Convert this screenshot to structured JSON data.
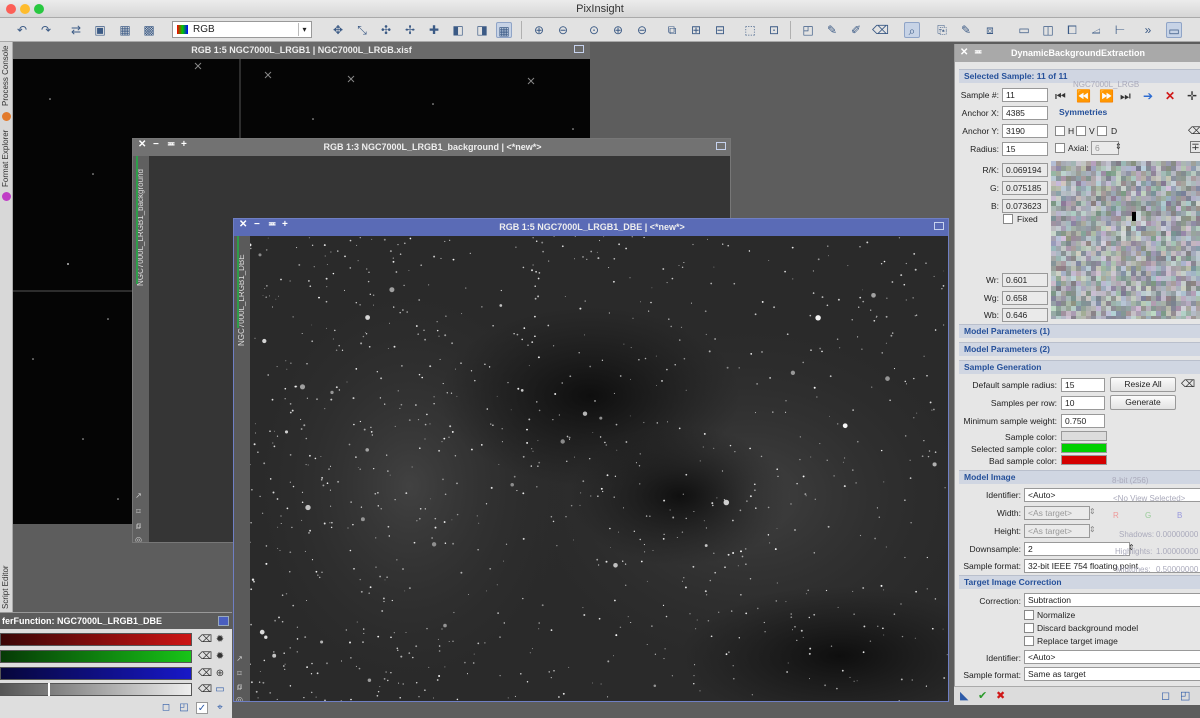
{
  "app": {
    "title": "PixInsight"
  },
  "toolbar": {
    "view_selector": "RGB"
  },
  "left_tabs": {
    "process_console": "Process Console",
    "format_explorer": "Format Explorer",
    "script_editor": "Script Editor"
  },
  "windows": {
    "w1": {
      "title": "RGB 1:5 NGC7000L_LRGB1 | NGC7000L_LRGB.xisf"
    },
    "w2": {
      "title": "RGB 1:3 NGC7000L_LRGB1_background | <*new*>",
      "side_label": "NGC7000L_LRGB1_background"
    },
    "w3": {
      "title": "RGB 1:5 NGC7000L_LRGB1_DBE | <*new*>",
      "side_label": "NGC7000L_LRGB1_DBE"
    }
  },
  "transfer": {
    "title": "ferFunction: NGC7000L_LRGB1_DBE",
    "red": "#cc1414",
    "green": "#18c418",
    "blue": "#1818c8"
  },
  "dbe": {
    "title": "DynamicBackgroundExtraction",
    "selected_sample": {
      "header": "Selected Sample: 11 of 11",
      "sample_no_label": "Sample #:",
      "sample_no": "11",
      "anchor_x_label": "Anchor X:",
      "anchor_x": "4385",
      "anchor_y_label": "Anchor Y:",
      "anchor_y": "3190",
      "radius_label": "Radius:",
      "radius": "15",
      "rk_label": "R/K:",
      "rk": "0.069194",
      "g_label": "G:",
      "g": "0.075185",
      "b_label": "B:",
      "b": "0.073623",
      "fixed_label": "Fixed",
      "wr_label": "Wr:",
      "wr": "0.601",
      "wg_label": "Wg:",
      "wg": "0.658",
      "wb_label": "Wb:",
      "wb": "0.646",
      "symmetries_label": "Symmetries",
      "h_label": "H",
      "v_label": "V",
      "d_label": "D",
      "axial_label": "Axial:",
      "axial": "6",
      "ghost_view_name": "NGC7000L_LRGB"
    },
    "model_params_1": "Model Parameters (1)",
    "model_params_2": "Model Parameters (2)",
    "sample_generation": {
      "header": "Sample Generation",
      "default_radius_label": "Default sample radius:",
      "default_radius": "15",
      "resize_all": "Resize All",
      "per_row_label": "Samples per row:",
      "per_row": "10",
      "generate": "Generate",
      "min_weight_label": "Minimum sample weight:",
      "min_weight": "0.750",
      "sample_color_label": "Sample color:",
      "sample_color": "#dcdcdc",
      "selected_color_label": "Selected sample color:",
      "selected_color": "#00d000",
      "bad_color_label": "Bad sample color:",
      "bad_color": "#d40000"
    },
    "model_image": {
      "header": "Model Image",
      "identifier_label": "Identifier:",
      "identifier": "<Auto>",
      "width_label": "Width:",
      "width": "<As target>",
      "height_label": "Height:",
      "height": "<As target>",
      "downsample_label": "Downsample:",
      "downsample": "2",
      "format_label": "Sample format:",
      "format": "32-bit IEEE 754 floating point",
      "ghost_bit": "8-bit (256)",
      "ghost_noview": "<No View Selected>",
      "ghost_r": "R",
      "ghost_g": "G",
      "ghost_b": "B",
      "ghost_shadows": "Shadows:",
      "ghost_shadows_val": "0.00000000",
      "ghost_highlights": "Highlights:",
      "ghost_highlights_val": "1.00000000",
      "ghost_midtones": "Midtones:",
      "ghost_midtones_val": "0.50000000"
    },
    "target_correction": {
      "header": "Target Image Correction",
      "correction_label": "Correction:",
      "correction": "Subtraction",
      "normalize": "Normalize",
      "discard": "Discard background model",
      "replace": "Replace target image",
      "identifier_label": "Identifier:",
      "identifier": "<Auto>",
      "format_label": "Sample format:",
      "format": "Same as target"
    }
  }
}
